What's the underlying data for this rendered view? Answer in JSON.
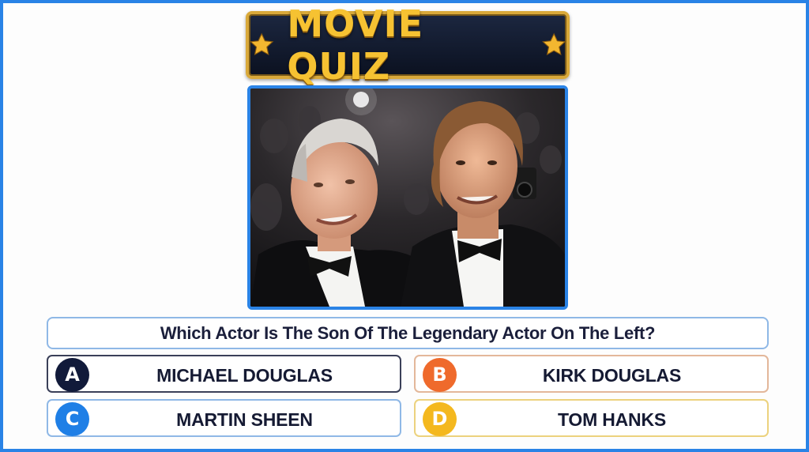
{
  "title": {
    "text": "MOVIE QUIZ",
    "left_icon": "star-icon",
    "right_icon": "star-icon"
  },
  "photo": {
    "description_icon": "photo-two-men-in-tuxedos"
  },
  "question": {
    "text": "Which Actor Is The Son Of The Legendary Actor On The Left?"
  },
  "answers": [
    {
      "letter": "A",
      "label": "MICHAEL DOUGLAS",
      "color": "#111a3a"
    },
    {
      "letter": "B",
      "label": "KIRK DOUGLAS",
      "color": "#ef6a2c"
    },
    {
      "letter": "C",
      "label": "MARTIN SHEEN",
      "color": "#1f7fe6"
    },
    {
      "letter": "D",
      "label": "TOM HANKS",
      "color": "#f4b81e"
    }
  ],
  "colors": {
    "frame": "#2a83e6",
    "title_gold": "#f6c232",
    "title_bg": "#0b1120"
  }
}
